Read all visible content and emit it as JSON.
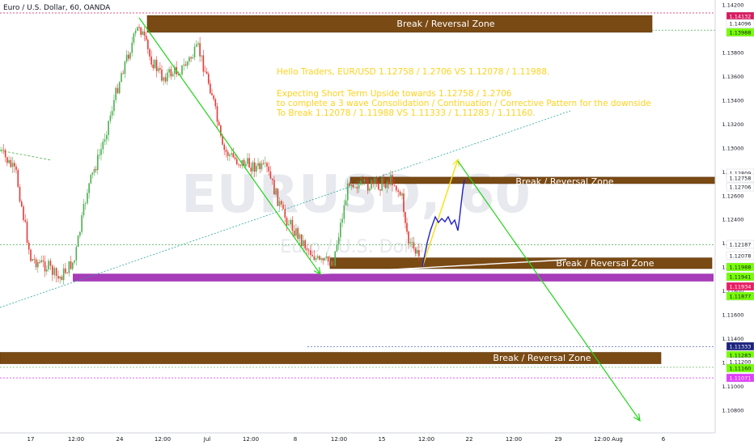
{
  "header": {
    "symbol_title": "Euro / U.S. Dollar, 60, OANDA"
  },
  "watermark": {
    "big": "EURUSD, 60",
    "small": "Euro / U.S. Dollar"
  },
  "analysis_note": {
    "lines": [
      "Hello Traders, EUR/USD 1.12758 / 1.2706 VS 1.12078 / 1.11988.",
      "",
      "Expecting Short Term Upside towards 1.12758 / 1.2706",
      "to complete a 3 wave Consolidation / Continuation / Corrective Pattern for the downside",
      "To Break 1.12078 / 1.11988 VS 1.11333 / 1.11283 / 1.11160."
    ]
  },
  "zones": [
    {
      "label": "Break / Reversal Zone",
      "top": 1.1411,
      "bottom": 1.1397,
      "x_start": "Jun 25 07:00",
      "x_end": "Jul 29 04:00"
    },
    {
      "label": "Break / Reversal Zone",
      "top": 1.12755,
      "bottom": 1.12705,
      "x_start": "Jul 11 06:00",
      "x_end": "Jul 31 12:00"
    },
    {
      "label": "Break / Reversal Zone",
      "top": 1.12078,
      "bottom": 1.11988,
      "x_start": "Jul 9 06:00",
      "x_end": "Aug 1 00:00"
    },
    {
      "label": "Break / Reversal Zone",
      "top": 1.11285,
      "bottom": 1.1119,
      "x_start": "Jun 16 00:00",
      "x_end": "Aug 1 00:00"
    }
  ],
  "colors": {
    "up_candle": "#4caf50",
    "down_candle": "#e53935",
    "zone_fill": "#7a4a14",
    "support_band": "#9c27b0",
    "arrow_green": "#21d41a",
    "arrow_yellow": "#f7e21a",
    "projection_blue": "#2020cc",
    "text_yellow": "#ffd21f"
  },
  "chart_data": {
    "type": "candlestick",
    "title": "Euro / U.S. Dollar, 60, OANDA",
    "ylim": [
      1.1072,
      1.1425
    ],
    "y_ticks": [
      "1.14200",
      "1.13800",
      "1.13600",
      "1.13400",
      "1.13200",
      "1.13000",
      "1.12800",
      "1.12600",
      "1.12400",
      "1.12200",
      "1.12000",
      "1.11800",
      "1.11600",
      "1.11400",
      "1.11200",
      "1.11000",
      "1.10800"
    ],
    "x_ticks": [
      "17",
      "12:00",
      "24",
      "12:00",
      "Jul",
      "12:00",
      "8",
      "12:00",
      "15",
      "12:00",
      "22",
      "12:00",
      "29",
      "12:00",
      "Aug",
      "6"
    ],
    "price_path": [
      [
        "Jun 14 00:00",
        1.1302
      ],
      [
        "Jun 15 06:00",
        1.1275
      ],
      [
        "Jun 17 00:00",
        1.121
      ],
      [
        "Jun 18 12:00",
        1.1195
      ],
      [
        "Jun 19 12:00",
        1.1185
      ],
      [
        "Jun 20 00:00",
        1.1205
      ],
      [
        "Jun 21 06:00",
        1.13
      ],
      [
        "Jun 22 00:00",
        1.1345
      ],
      [
        "Jun 23 06:00",
        1.139
      ],
      [
        "Jun 24 12:00",
        1.1412
      ],
      [
        "Jun 25 12:00",
        1.1385
      ],
      [
        "Jun 27 00:00",
        1.1365
      ],
      [
        "Jun 28 12:00",
        1.138
      ],
      [
        "Jun 29 06:00",
        1.1395
      ],
      [
        "Jun 30 06:00",
        1.136
      ],
      [
        "Jul 1 06:00",
        1.131
      ],
      [
        "Jul 2 12:00",
        1.129
      ],
      [
        "Jul 4 00:00",
        1.128
      ],
      [
        "Jul 5 12:00",
        1.1255
      ],
      [
        "Jul 6 12:00",
        1.123
      ],
      [
        "Jul 7 12:00",
        1.1212
      ],
      [
        "Jul 8 12:00",
        1.12
      ],
      [
        "Jul 9 12:00",
        1.1202
      ],
      [
        "Jul 10 06:00",
        1.1272
      ],
      [
        "Jul 11 00:00",
        1.127
      ],
      [
        "Jul 12 12:00",
        1.1265
      ],
      [
        "Jul 14 00:00",
        1.127
      ],
      [
        "Jul 15 00:00",
        1.1278
      ],
      [
        "Jul 16 00:00",
        1.1255
      ],
      [
        "Jul 16 18:00",
        1.1215
      ],
      [
        "Jul 17 06:00",
        1.12
      ]
    ],
    "series": [
      {
        "name": "Current price",
        "value": 1.12187
      }
    ],
    "price_labels": [
      {
        "text": "1.14132",
        "value": 1.14132,
        "bg": "#d81b60",
        "fg": "#ffffff"
      },
      {
        "text": "1.14096",
        "value": 1.14096,
        "bg": "#ffffff",
        "fg": "#131722"
      },
      {
        "text": "1.13988",
        "value": 1.13988,
        "bg": "#76ff03",
        "fg": "#131722"
      },
      {
        "text": "1.12809",
        "value": 1.12809,
        "bg": "#ffffff",
        "fg": "#131722"
      },
      {
        "text": "1.12758",
        "value": 1.12758,
        "bg": "#ffffff",
        "fg": "#131722"
      },
      {
        "text": "1.12706",
        "value": 1.12706,
        "bg": "#ffffff",
        "fg": "#131722"
      },
      {
        "text": "1.12187",
        "value": 1.12187,
        "bg": "#ffffff",
        "fg": "#131722"
      },
      {
        "text": "1.12078",
        "value": 1.12078,
        "bg": "#ffffff",
        "fg": "#131722"
      },
      {
        "text": "1.11988",
        "value": 1.11988,
        "bg": "#76ff03",
        "fg": "#131722"
      },
      {
        "text": "1.11941",
        "value": 1.11941,
        "bg": "#76ff03",
        "fg": "#131722"
      },
      {
        "text": "1.11934",
        "value": 1.11934,
        "bg": "#e91e63",
        "fg": "#ffffff"
      },
      {
        "text": "1.11877",
        "value": 1.11877,
        "bg": "#76ff03",
        "fg": "#131722"
      },
      {
        "text": "1.11333",
        "value": 1.11333,
        "bg": "#1a237e",
        "fg": "#ffffff"
      },
      {
        "text": "1.11283",
        "value": 1.11283,
        "bg": "#76ff03",
        "fg": "#131722"
      },
      {
        "text": "1.11200",
        "value": 1.112,
        "bg": "#ffffff",
        "fg": "#131722"
      },
      {
        "text": "1.11160",
        "value": 1.1116,
        "bg": "#76ff03",
        "fg": "#131722"
      },
      {
        "text": "1.11071",
        "value": 1.11071,
        "bg": "#e040fb",
        "fg": "#ffffff"
      }
    ],
    "drawings": [
      {
        "kind": "arrow",
        "color": "green",
        "from": [
          "Jun 25 00:00",
          1.1413
        ],
        "to": [
          "Jul 9 06:00",
          1.1193
        ]
      },
      {
        "kind": "arrow",
        "color": "yellow",
        "from": [
          "Jul 17 12:00",
          1.1198
        ],
        "to": [
          "Jul 20 12:00",
          1.1295
        ]
      },
      {
        "kind": "arrow",
        "color": "green",
        "from": [
          "Jul 20 12:00",
          1.1295
        ],
        "to": [
          "Aug 5 06:00",
          1.1083
        ]
      },
      {
        "kind": "trend",
        "color": "white",
        "from": [
          "Jul 9 12:00",
          1.1284
        ],
        "to": [
          "Jul 27 18:00",
          1.1297
        ]
      },
      {
        "kind": "trend",
        "color": "white",
        "from": [
          "Jul 9 06:00",
          1.1193
        ],
        "to": [
          "Jul 27 12:00",
          1.1207
        ]
      },
      {
        "kind": "trend",
        "color": "teal-dotted",
        "from": [
          "Jun 14 00:00",
          1.117
        ],
        "to": [
          "Jul 27 12:00",
          1.1337
        ]
      },
      {
        "kind": "band",
        "color": "purple",
        "top": 1.11945,
        "bottom": 1.1188,
        "x_start": "Jun 18 12:00",
        "x_end": "Aug 1 00:00"
      }
    ]
  }
}
